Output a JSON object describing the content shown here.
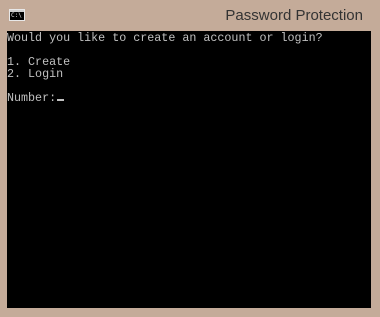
{
  "window": {
    "title": "Password Protection",
    "icon": "cmd-icon",
    "icon_glyph": "C:\\"
  },
  "console": {
    "prompt_question": "Would you like to create an account or login?",
    "options": [
      "1. Create",
      "2. Login"
    ],
    "input_label": "Number:",
    "input_value": "",
    "colors": {
      "background": "#000000",
      "text": "#c0c0c0",
      "frame": "#c4ab99"
    }
  }
}
